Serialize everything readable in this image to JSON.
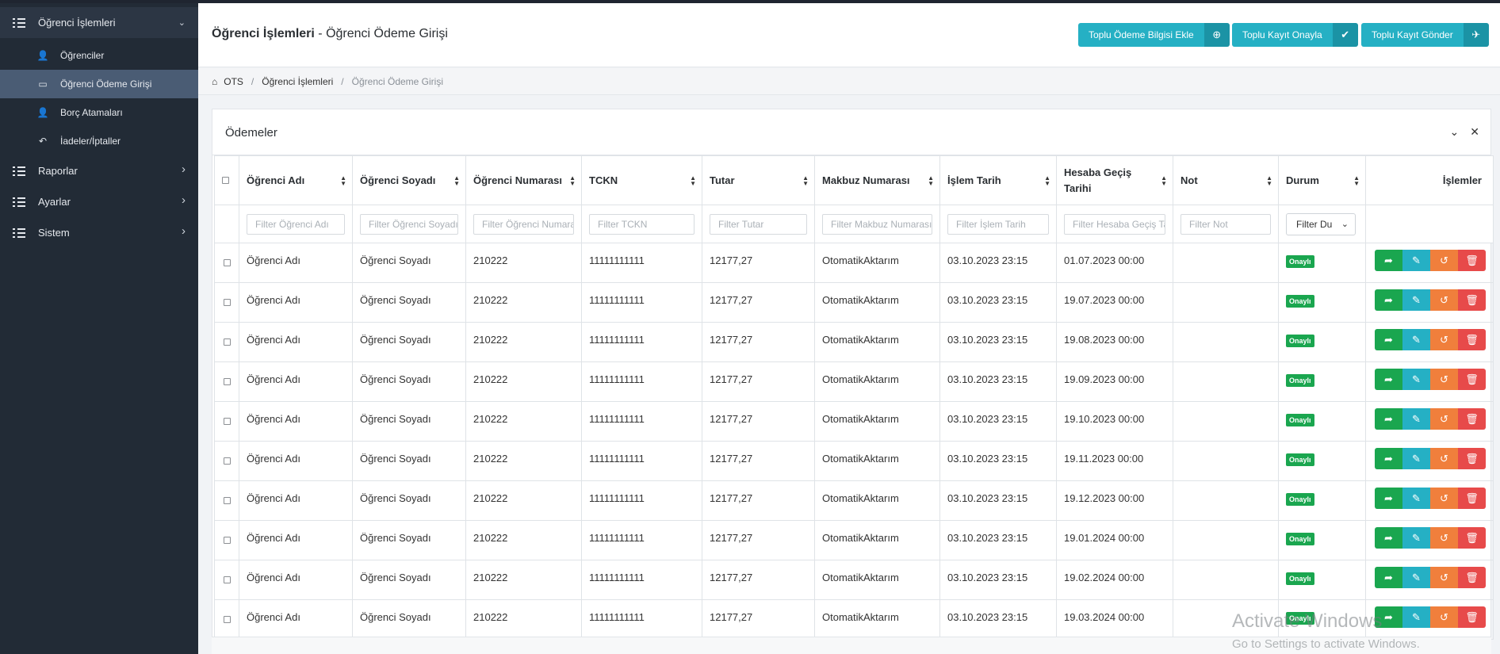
{
  "sidebar": {
    "items": [
      {
        "label": "Öğrenci İşlemleri",
        "chevron": "⌄"
      },
      {
        "label": "Raporlar",
        "chevron": "›"
      },
      {
        "label": "Ayarlar",
        "chevron": "›"
      },
      {
        "label": "Sistem",
        "chevron": "›"
      }
    ],
    "subitems": [
      {
        "label": "Öğrenciler",
        "icon": "user-icon"
      },
      {
        "label": "Öğrenci Ödeme Girişi",
        "icon": "credit-card-icon"
      },
      {
        "label": "Borç Atamaları",
        "icon": "user-money-icon"
      },
      {
        "label": "İadeler/İptaller",
        "icon": "undo-icon"
      }
    ]
  },
  "header": {
    "title_bold": "Öğrenci İşlemleri",
    "title_rest": " - Öğrenci Ödeme Girişi",
    "buttons": [
      {
        "label": "Toplu Ödeme Bilgisi Ekle",
        "icon": "⊕"
      },
      {
        "label": "Toplu Kayıt Onayla",
        "icon": "✔"
      },
      {
        "label": "Toplu Kayıt Gönder",
        "icon": "✈"
      }
    ]
  },
  "breadcrumb": {
    "items": [
      "OTS",
      "Öğrenci İşlemleri",
      "Öğrenci Ödeme Girişi"
    ],
    "separator": "/"
  },
  "card": {
    "title": "Ödemeler",
    "collapse_icon": "⌄",
    "close_icon": "✕"
  },
  "table": {
    "headers": [
      "Öğrenci Adı",
      "Öğrenci Soyadı",
      "Öğrenci Numarası",
      "TCKN",
      "Tutar",
      "Makbuz Numarası",
      "İşlem Tarih",
      "Hesaba Geçiş Tarihi",
      "Not",
      "Durum",
      "İşlemler"
    ],
    "filters": [
      "Filter Öğrenci Adı",
      "Filter Öğrenci Soyadı",
      "Filter Öğrenci Numarası",
      "Filter TCKN",
      "Filter Tutar",
      "Filter Makbuz Numarası",
      "Filter İşlem Tarih",
      "Filter Hesaba Geçiş Tarihi",
      "Filter Not"
    ],
    "status_filter": "Filter Du",
    "rows": [
      {
        "ad": "Öğrenci Adı",
        "soyad": "Öğrenci Soyadı",
        "no": "210222",
        "tckn": "11111111111",
        "tutar": "12177,27",
        "makbuz": "OtomatikAktarım",
        "islem": "03.10.2023 23:15",
        "gecis": "01.07.2023 00:00",
        "not": "",
        "durum": "Onaylı"
      },
      {
        "ad": "Öğrenci Adı",
        "soyad": "Öğrenci Soyadı",
        "no": "210222",
        "tckn": "11111111111",
        "tutar": "12177,27",
        "makbuz": "OtomatikAktarım",
        "islem": "03.10.2023 23:15",
        "gecis": "19.07.2023 00:00",
        "not": "",
        "durum": "Onaylı"
      },
      {
        "ad": "Öğrenci Adı",
        "soyad": "Öğrenci Soyadı",
        "no": "210222",
        "tckn": "11111111111",
        "tutar": "12177,27",
        "makbuz": "OtomatikAktarım",
        "islem": "03.10.2023 23:15",
        "gecis": "19.08.2023 00:00",
        "not": "",
        "durum": "Onaylı"
      },
      {
        "ad": "Öğrenci Adı",
        "soyad": "Öğrenci Soyadı",
        "no": "210222",
        "tckn": "11111111111",
        "tutar": "12177,27",
        "makbuz": "OtomatikAktarım",
        "islem": "03.10.2023 23:15",
        "gecis": "19.09.2023 00:00",
        "not": "",
        "durum": "Onaylı"
      },
      {
        "ad": "Öğrenci Adı",
        "soyad": "Öğrenci Soyadı",
        "no": "210222",
        "tckn": "11111111111",
        "tutar": "12177,27",
        "makbuz": "OtomatikAktarım",
        "islem": "03.10.2023 23:15",
        "gecis": "19.10.2023 00:00",
        "not": "",
        "durum": "Onaylı"
      },
      {
        "ad": "Öğrenci Adı",
        "soyad": "Öğrenci Soyadı",
        "no": "210222",
        "tckn": "11111111111",
        "tutar": "12177,27",
        "makbuz": "OtomatikAktarım",
        "islem": "03.10.2023 23:15",
        "gecis": "19.11.2023 00:00",
        "not": "",
        "durum": "Onaylı"
      },
      {
        "ad": "Öğrenci Adı",
        "soyad": "Öğrenci Soyadı",
        "no": "210222",
        "tckn": "11111111111",
        "tutar": "12177,27",
        "makbuz": "OtomatikAktarım",
        "islem": "03.10.2023 23:15",
        "gecis": "19.12.2023 00:00",
        "not": "",
        "durum": "Onaylı"
      },
      {
        "ad": "Öğrenci Adı",
        "soyad": "Öğrenci Soyadı",
        "no": "210222",
        "tckn": "11111111111",
        "tutar": "12177,27",
        "makbuz": "OtomatikAktarım",
        "islem": "03.10.2023 23:15",
        "gecis": "19.01.2024 00:00",
        "not": "",
        "durum": "Onaylı"
      },
      {
        "ad": "Öğrenci Adı",
        "soyad": "Öğrenci Soyadı",
        "no": "210222",
        "tckn": "11111111111",
        "tutar": "12177,27",
        "makbuz": "OtomatikAktarım",
        "islem": "03.10.2023 23:15",
        "gecis": "19.02.2024 00:00",
        "not": "",
        "durum": "Onaylı"
      },
      {
        "ad": "Öğrenci Adı",
        "soyad": "Öğrenci Soyadı",
        "no": "210222",
        "tckn": "11111111111",
        "tutar": "12177,27",
        "makbuz": "OtomatikAktarım",
        "islem": "03.10.2023 23:15",
        "gecis": "19.03.2024 00:00",
        "not": "",
        "durum": "Onaylı"
      }
    ],
    "row_actions": [
      {
        "name": "share-icon",
        "glyph": "➦"
      },
      {
        "name": "edit-icon",
        "glyph": "✎"
      },
      {
        "name": "undo-icon",
        "glyph": "↺"
      },
      {
        "name": "trash-icon",
        "glyph": "🗑"
      }
    ]
  },
  "watermark": {
    "line1": "Activate Windows",
    "line2": "Go to Settings to activate Windows."
  },
  "colors": {
    "sidebar_bg": "#222b36",
    "accent_cyan": "#25b0c4",
    "success_green": "#1aa64f",
    "warning_orange": "#f07f3c",
    "danger_red": "#e74a4a"
  }
}
